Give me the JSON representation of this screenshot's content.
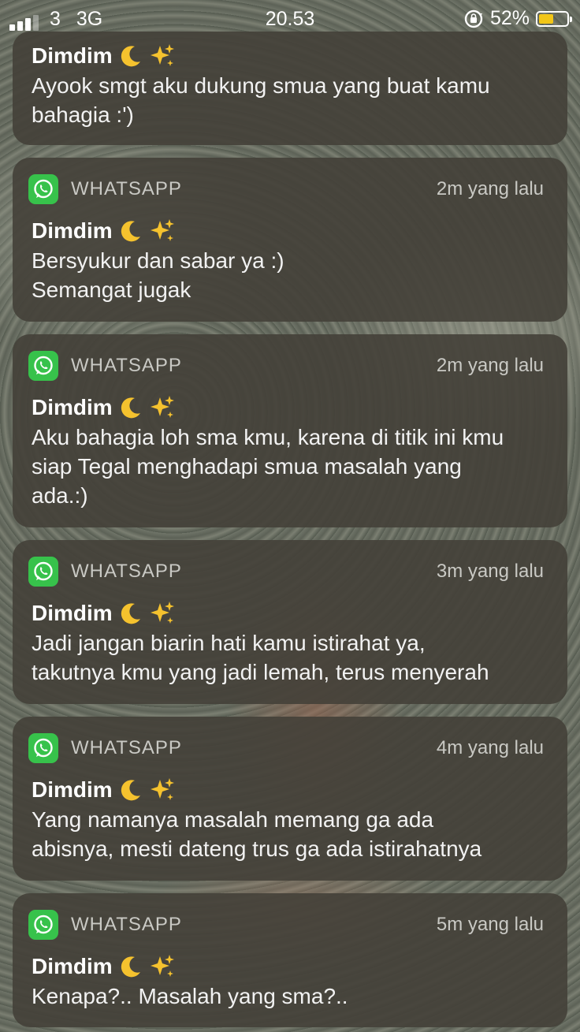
{
  "status_bar": {
    "carrier": "3",
    "network": "3G",
    "time": "20.53",
    "battery_percent": "52%",
    "battery_level": 0.52,
    "battery_color": "#f2c618"
  },
  "notifications": [
    {
      "sender": "Dimdim",
      "message": "Ayook smgt aku dukung smua yang buat kamu\nbahagia :')"
    },
    {
      "app": "WHATSAPP",
      "time": "2m yang lalu",
      "sender": "Dimdim",
      "message": "Bersyukur dan sabar ya :)\nSemangat jugak"
    },
    {
      "app": "WHATSAPP",
      "time": "2m yang lalu",
      "sender": "Dimdim",
      "message": "Aku bahagia loh sma kmu, karena di titik ini kmu\nsiap Tegal menghadapi smua masalah yang\nada.:)"
    },
    {
      "app": "WHATSAPP",
      "time": "3m yang lalu",
      "sender": "Dimdim",
      "message": "Jadi jangan biarin hati kamu istirahat ya,\ntakutnya kmu yang jadi lemah, terus menyerah"
    },
    {
      "app": "WHATSAPP",
      "time": "4m yang lalu",
      "sender": "Dimdim",
      "message": "Yang namanya masalah memang ga ada\nabisnya, mesti dateng trus  ga ada istirahatnya"
    },
    {
      "app": "WHATSAPP",
      "time": "5m yang lalu",
      "sender": "Dimdim",
      "message": "Kenapa?.. Masalah yang sma?.."
    }
  ],
  "icons": {
    "app_icon": "whatsapp-icon",
    "sender_emoji": [
      "crescent-moon-icon",
      "sparkles-icon"
    ],
    "whatsapp_green": "#37c24b"
  }
}
